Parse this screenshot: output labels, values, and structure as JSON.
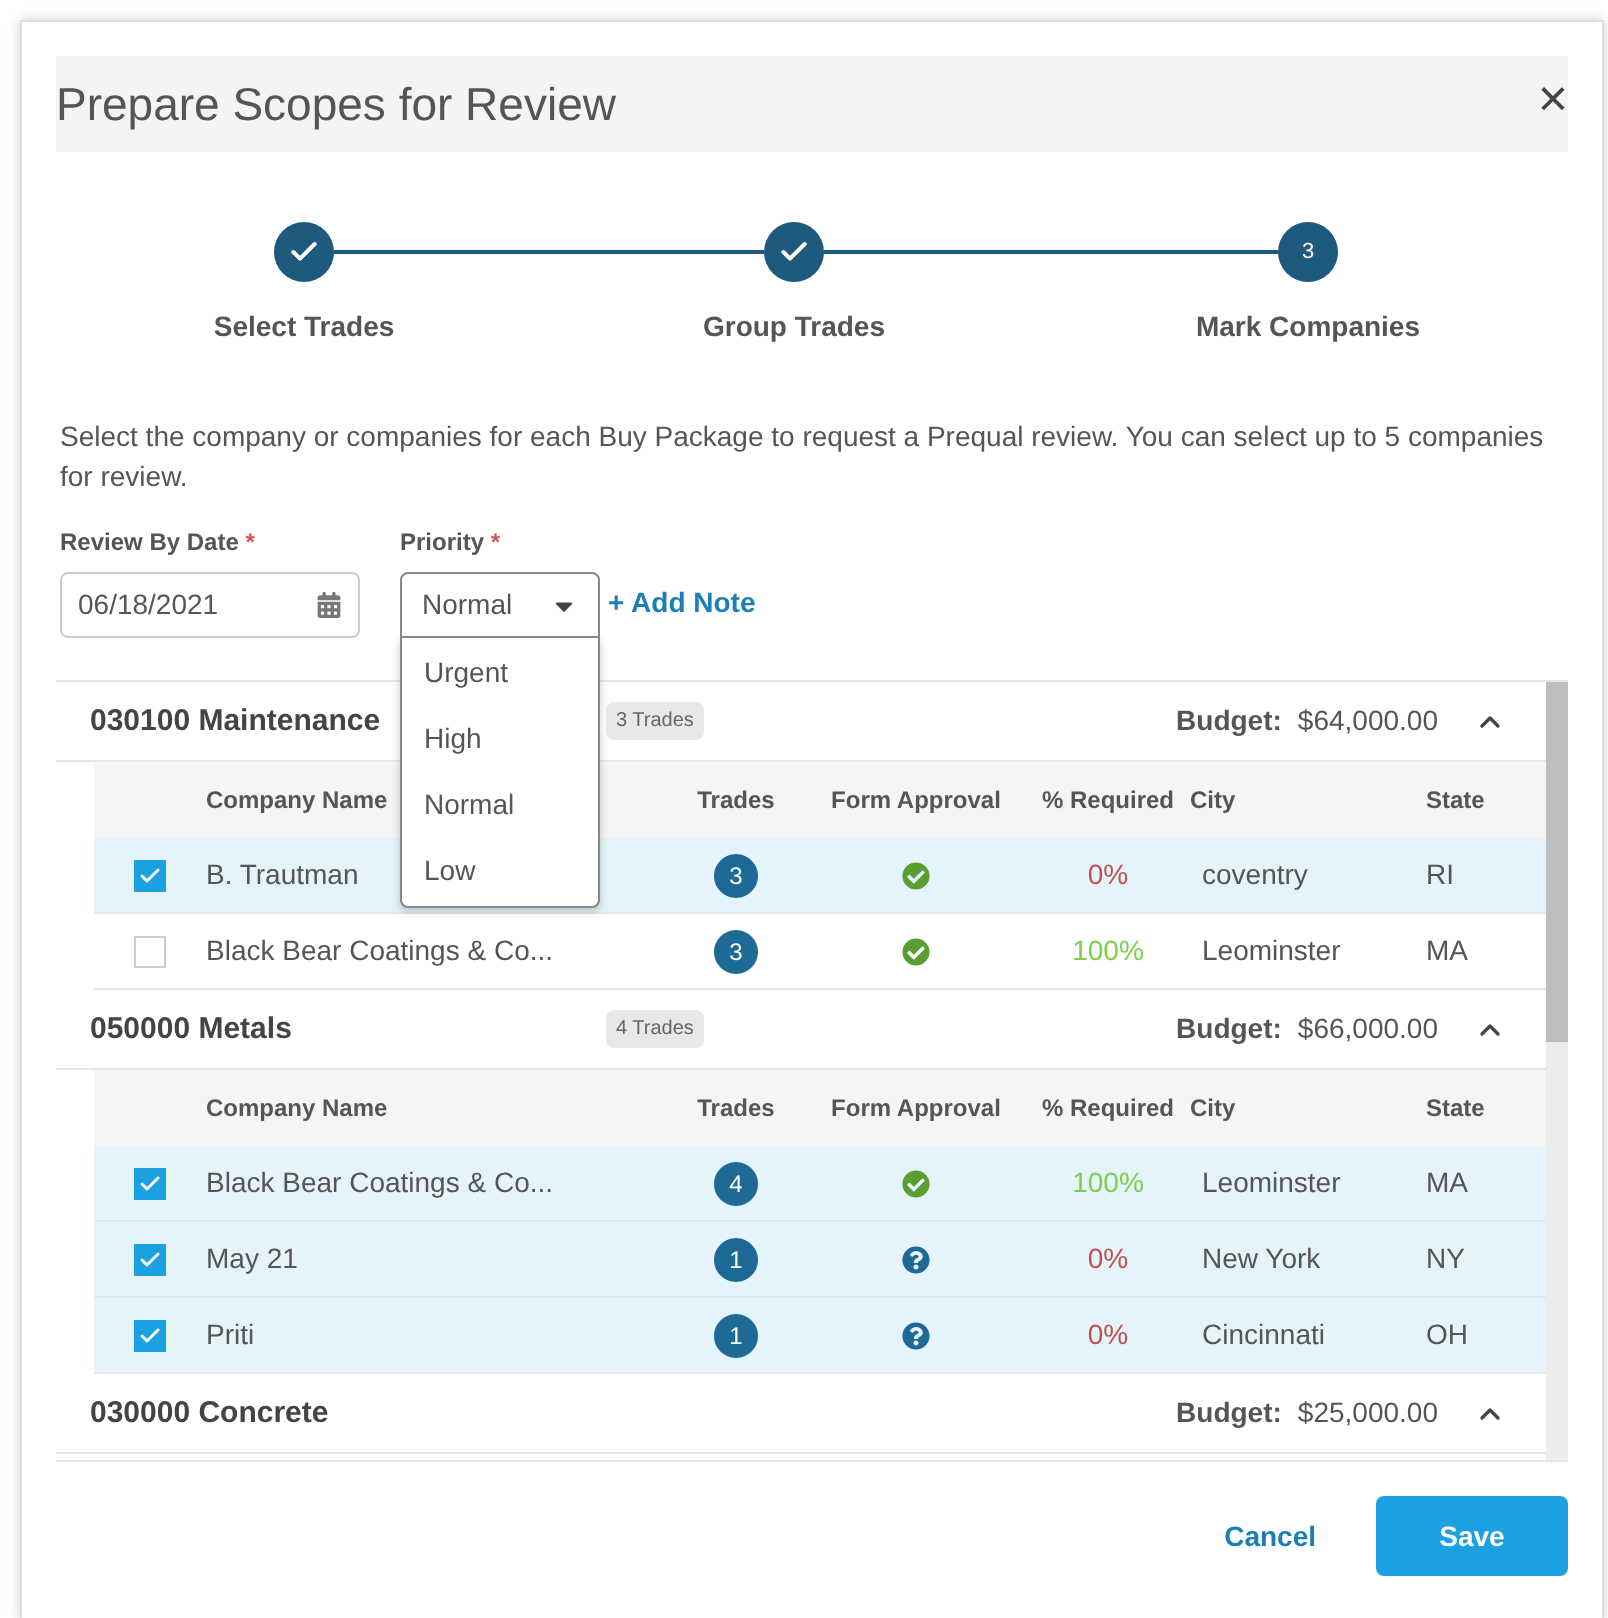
{
  "dialog": {
    "title": "Prepare Scopes for Review",
    "close": "×"
  },
  "steps": [
    {
      "label": "Select Trades",
      "completed": true
    },
    {
      "label": "Group Trades",
      "completed": true
    },
    {
      "label": "Mark Companies",
      "completed": false,
      "number": "3"
    }
  ],
  "description": "Select the company or companies for each Buy Package to request a Prequal review. You can select up to 5 companies for review.",
  "review_date": {
    "label": "Review By Date",
    "required_mark": "*",
    "value": "06/18/2021"
  },
  "priority": {
    "label": "Priority",
    "required_mark": "*",
    "value": "Normal",
    "expanded": true,
    "options": [
      "Urgent",
      "High",
      "Normal",
      "Low"
    ]
  },
  "add_note": "+ Add Note",
  "groups": [
    {
      "name": "030100 Maintenance",
      "badge": "3 Trades",
      "budget_label": "Budget:",
      "budget": "$64,000.00",
      "expanded": true,
      "columns": [
        "Company Name",
        "Trades",
        "Form Approval",
        "% Required",
        "City",
        "State"
      ],
      "rows": [
        {
          "checked": true,
          "company": "B. Trautman",
          "trades": "3",
          "form_approved": true,
          "required": "0%",
          "required_met": false,
          "city": "coventry",
          "state": "RI"
        },
        {
          "checked": false,
          "company": "Black Bear Coatings & Co...",
          "trades": "3",
          "form_approved": true,
          "required": "100%",
          "required_met": true,
          "city": "Leominster",
          "state": "MA"
        }
      ]
    },
    {
      "name": "050000 Metals",
      "badge": "4 Trades",
      "budget_label": "Budget:",
      "budget": "$66,000.00",
      "expanded": true,
      "columns": [
        "Company Name",
        "Trades",
        "Form Approval",
        "% Required",
        "City",
        "State"
      ],
      "rows": [
        {
          "checked": true,
          "company": "Black Bear Coatings & Co...",
          "trades": "4",
          "form_approved": true,
          "required": "100%",
          "required_met": true,
          "city": "Leominster",
          "state": "MA"
        },
        {
          "checked": true,
          "company": "May 21",
          "trades": "1",
          "form_approved": false,
          "required": "0%",
          "required_met": false,
          "city": "New York",
          "state": "NY"
        },
        {
          "checked": true,
          "company": "Priti",
          "trades": "1",
          "form_approved": false,
          "required": "0%",
          "required_met": false,
          "city": "Cincinnati",
          "state": "OH"
        }
      ]
    },
    {
      "name": "030000 Concrete",
      "budget_label": "Budget:",
      "budget": "$25,000.00",
      "expanded": true
    }
  ],
  "buttons": {
    "cancel": "Cancel",
    "save": "Save"
  }
}
